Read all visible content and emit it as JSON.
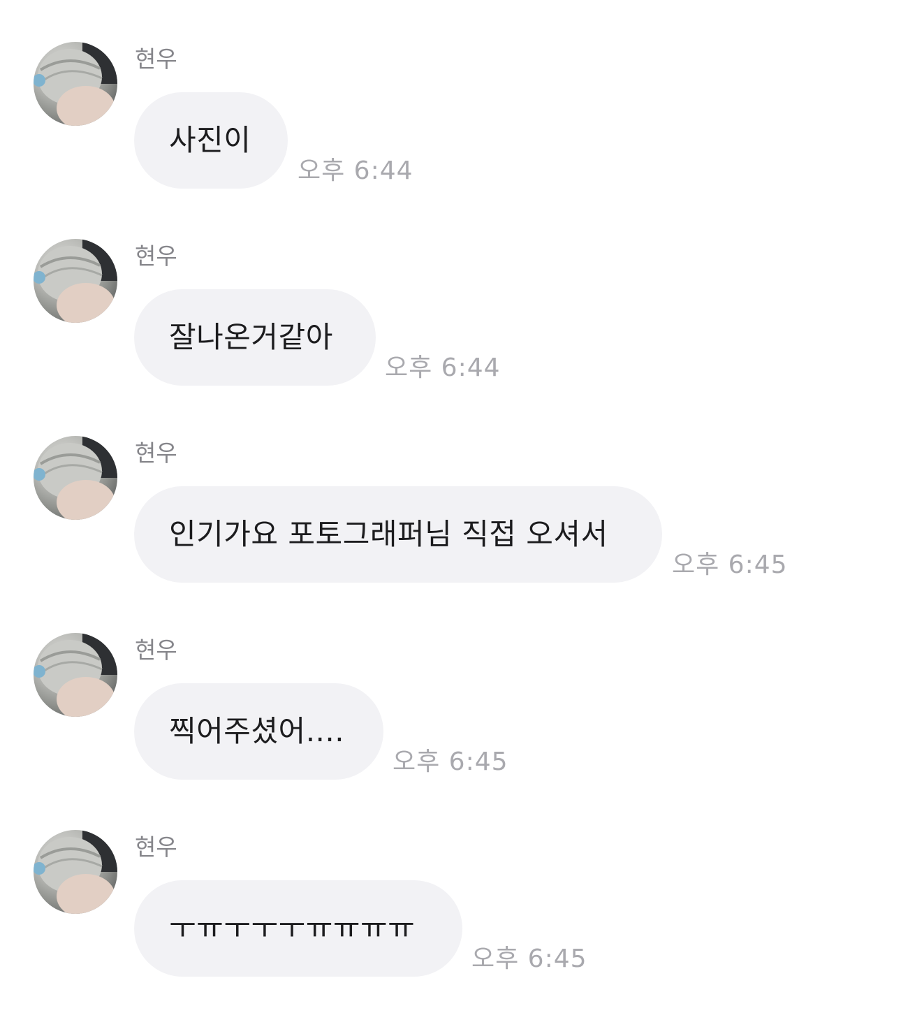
{
  "messages": [
    {
      "sender": "현우",
      "text": "사진이",
      "time": "오후 6:44"
    },
    {
      "sender": "현우",
      "text": "잘나온거같아",
      "time": "오후 6:44"
    },
    {
      "sender": "현우",
      "text": "인기가요 포토그래퍼님 직접 오셔서",
      "time": "오후 6:45"
    },
    {
      "sender": "현우",
      "text": "찍어주셨어....",
      "time": "오후 6:45"
    },
    {
      "sender": "현우",
      "text": "ㅜㅠㅜㅜㅜㅠㅠㅠㅠ",
      "time": "오후 6:45"
    }
  ],
  "colors": {
    "bubble": "#f2f2f5",
    "sender": "#86868b",
    "time": "#a9a9ae",
    "text": "#1c1c1e"
  }
}
